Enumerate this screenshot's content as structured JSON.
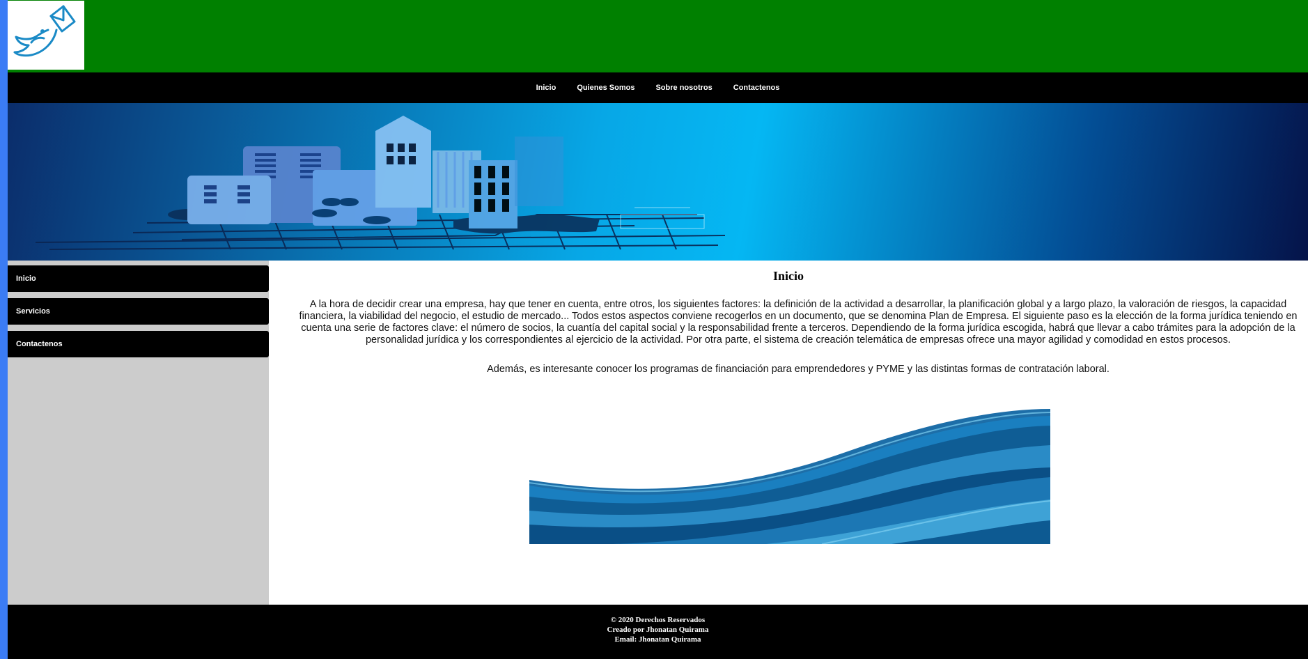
{
  "nav": {
    "items": [
      "Inicio",
      "Quienes Somos",
      "Sobre nosotros",
      "Contactenos"
    ]
  },
  "sidebar": {
    "items": [
      "Inicio",
      "Servicios",
      "Contactenos"
    ]
  },
  "main": {
    "title": "Inicio",
    "paragraph1": "A la hora de decidir crear una empresa, hay que tener en cuenta, entre otros, los siguientes factores: la definición de la actividad a desarrollar, la planificación global y a largo plazo, la valoración de riesgos, la capacidad financiera, la viabilidad del negocio, el estudio de mercado... Todos estos aspectos conviene recogerlos en un documento, que se denomina Plan de Empresa. El siguiente paso es la elección de la forma jurídica teniendo en cuenta una serie de factores clave: el número de socios, la cuantía del capital social y la responsabilidad frente a terceros. Dependiendo de la forma jurídica escogida, habrá que llevar a cabo trámites para la adopción de la personalidad jurídica y los correspondientes al ejercicio de la actividad. Por otra parte, el sistema de creación telemática de empresas ofrece una mayor agilidad y comodidad en estos procesos.",
    "paragraph2": "Además, es interesante conocer los programas de financiación para emprendedores y PYME y las distintas formas de contratación laboral."
  },
  "footer": {
    "line1": "© 2020 Derechos Reservados",
    "line2": "Creado por Jhonatan Quirama",
    "line3": "Email: Jhonatan Quirama"
  },
  "colors": {
    "header_green": "#008000",
    "nav_black": "#000000",
    "left_strip_blue": "#3b7cf5",
    "sidebar_gray": "#cccccc",
    "logo_blue": "#1a8ac6"
  },
  "icons": {
    "logo": "bird-envelope-logo"
  }
}
